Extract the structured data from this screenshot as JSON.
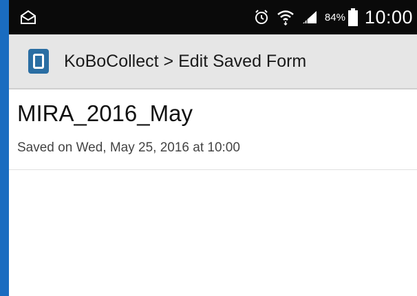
{
  "status_bar": {
    "icons": [
      "mail-icon",
      "alarm-icon",
      "wifi-icon",
      "signal-icon",
      "battery-icon"
    ],
    "battery_percent": "84%",
    "time": "10:00"
  },
  "action_bar": {
    "title": "KoBoCollect > Edit Saved Form",
    "app_icon": "kobocollect-app-icon",
    "color": "#2a6ea3"
  },
  "forms": [
    {
      "name": "MIRA_2016_May",
      "saved": "Saved on Wed, May 25, 2016 at 10:00"
    }
  ]
}
